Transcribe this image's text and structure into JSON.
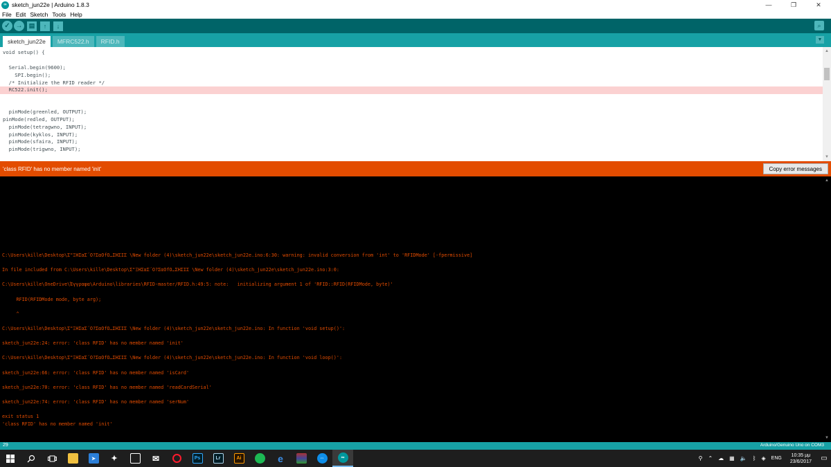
{
  "window": {
    "title": "sketch_jun22e | Arduino 1.8.3",
    "app_icon": "∞",
    "controls": {
      "minimize": "—",
      "maximize": "❐",
      "close": "✕"
    }
  },
  "menu": [
    "File",
    "Edit",
    "Sketch",
    "Tools",
    "Help"
  ],
  "toolbar": {
    "verify_icon": "✓",
    "upload_icon": "→",
    "new_icon": "▤",
    "open_icon": "↑",
    "save_icon": "↓",
    "serial_icon": "⌕"
  },
  "tabs": [
    {
      "label": "sketch_jun22e",
      "active": true
    },
    {
      "label": "MFRC522.h",
      "active": false
    },
    {
      "label": "RFID.h",
      "active": false
    }
  ],
  "tab_menu_icon": "▼",
  "editor": {
    "lines": {
      "l1": "void setup() {",
      "l2": "  Serial.begin(9600);",
      "l3": "    SPI.begin();",
      "l4": "  /* Initialize the RFID reader */",
      "l5": "  RC522.init();",
      "l6": "  pinMode(greenled, OUTPUT);",
      "l7": "pinMode(redled, OUTPUT);",
      "l8": "  pinMode(tetragwno, INPUT);",
      "l9": "  pinMode(kyklos, INPUT);",
      "l10": "  pinMode(sfaira, INPUT);",
      "l11": "  pinMode(trigwno, INPUT);"
    }
  },
  "error_bar": {
    "message": "'class RFID' has no member named 'init'",
    "copy_button": "Copy error messages"
  },
  "console": {
    "lines": [
      "C:\\Users\\kille\\Desktop\\Σ\"ΞΗΣαΣ΄Ο?ΣαΟfΟ…ΣΗΣΙΣ \\New folder (4)\\sketch_jun22e\\sketch_jun22e.ino:6:30: warning: invalid conversion from 'int' to 'RFIDMode' [-fpermissive]",
      "In file included from C:\\Users\\kille\\Desktop\\Σ\"ΞΗΣαΣ΄Ο?ΣαΟfΟ…ΣΗΣΙΣ \\New folder (4)\\sketch_jun22e\\sketch_jun22e.ino:3:0:",
      "C:\\Users\\kille\\OneDrive\\Έγγραφα\\Arduino\\libraries\\RFID-master/RFID.h:49:5: note:   initializing argument 1 of 'RFID::RFID(RFIDMode, byte)'",
      "     RFID(RFIDMode mode, byte arg);",
      "     ^",
      "C:\\Users\\kille\\Desktop\\Σ\"ΞΗΣαΣ΄Ο?ΣαΟfΟ…ΣΗΣΙΣ \\New folder (4)\\sketch_jun22e\\sketch_jun22e.ino: In function 'void setup()':",
      "sketch_jun22e:24: error: 'class RFID' has no member named 'init'",
      "C:\\Users\\kille\\Desktop\\Σ\"ΞΗΣαΣ΄Ο?ΣαΟfΟ…ΣΗΣΙΣ \\New folder (4)\\sketch_jun22e\\sketch_jun22e.ino: In function 'void loop()':",
      "sketch_jun22e:66: error: 'class RFID' has no member named 'isCard'",
      "sketch_jun22e:70: error: 'class RFID' has no member named 'readCardSerial'",
      "sketch_jun22e:74: error: 'class RFID' has no member named 'serNum'",
      "exit status 1",
      "'class RFID' has no member named 'init'"
    ]
  },
  "status": {
    "line_number": "29",
    "board": "Arduino/Genuino Uno on COM3"
  },
  "taskbar": {
    "apps": [
      {
        "name": "ps",
        "label": "Ps",
        "bg": "#001d26",
        "fg": "#31a8ff"
      },
      {
        "name": "lr",
        "label": "Lr",
        "bg": "#001d26",
        "fg": "#add5ec"
      },
      {
        "name": "ai",
        "label": "Ai",
        "bg": "#261300",
        "fg": "#ff9a00"
      }
    ],
    "language": "ENG",
    "time": "10:35 μμ",
    "date": "23/6/2017"
  },
  "colors": {
    "toolbar": "#006468",
    "tabbar": "#17a1a5",
    "error": "#e34c00",
    "error_line_bg": "#fbd1d1"
  }
}
